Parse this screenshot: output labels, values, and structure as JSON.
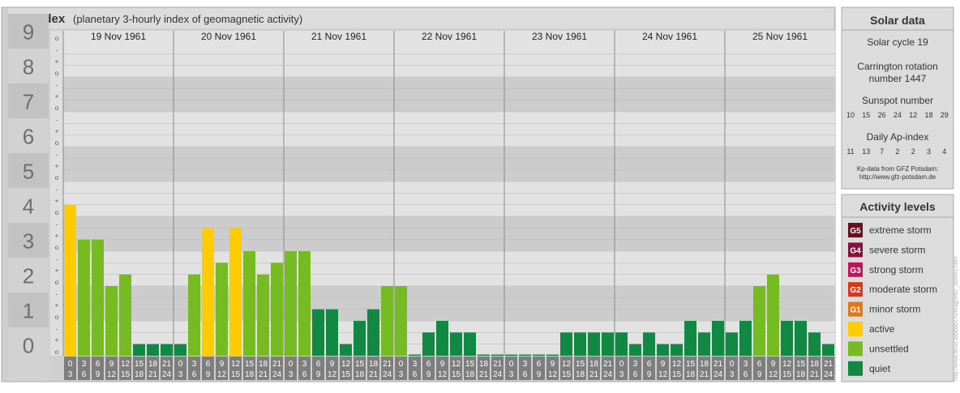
{
  "header": {
    "title": "Kp-index",
    "subtitle": "(planetary 3-hourly index of geomagnetic activity)"
  },
  "colors": {
    "quiet": "#118844",
    "unsettled": "#77bb22",
    "active": "#ffcc00",
    "G1": "#e07818",
    "G2": "#d83818",
    "G3": "#c0145a",
    "G4": "#881040",
    "G5": "#661020",
    "tile": "#7e7e7e",
    "panel": "#dcdcdc"
  },
  "chart_data": {
    "type": "bar",
    "ylim": [
      0,
      9
    ],
    "y_major_ticks": [
      "0",
      "1",
      "2",
      "3",
      "4",
      "5",
      "6",
      "7",
      "8",
      "9"
    ],
    "y_minor_ticks": [
      "-",
      "o",
      "+"
    ],
    "days": [
      "19 Nov 1961",
      "20 Nov 1961",
      "21 Nov 1961",
      "22 Nov 1961",
      "23 Nov 1961",
      "24 Nov 1961",
      "25 Nov 1961"
    ],
    "interval_labels": [
      [
        "0",
        "3"
      ],
      [
        "3",
        "6"
      ],
      [
        "6",
        "9"
      ],
      [
        "9",
        "12"
      ],
      [
        "12",
        "15"
      ],
      [
        "15",
        "18"
      ],
      [
        "18",
        "21"
      ],
      [
        "21",
        "24"
      ]
    ],
    "values": [
      [
        4.333,
        3.333,
        3.333,
        2.0,
        2.333,
        0.333,
        0.333,
        0.333
      ],
      [
        0.333,
        2.333,
        3.667,
        2.667,
        3.667,
        3.0,
        2.333,
        2.667
      ],
      [
        3.0,
        3.0,
        1.333,
        1.333,
        0.333,
        1.0,
        1.333,
        2.0
      ],
      [
        2.0,
        0.0,
        0.667,
        1.0,
        0.667,
        0.667,
        0.0,
        0.0
      ],
      [
        0.0,
        0.0,
        0.0,
        0.0,
        0.667,
        0.667,
        0.667,
        0.667
      ],
      [
        0.667,
        0.333,
        0.667,
        0.333,
        0.333,
        1.0,
        0.667,
        1.0
      ],
      [
        0.667,
        1.0,
        2.0,
        2.333,
        1.0,
        1.0,
        0.667,
        0.333
      ]
    ]
  },
  "solar": {
    "title": "Solar data",
    "cycle": "Solar cycle 19",
    "carrington_line1": "Carrington rotation",
    "carrington_line2": "number 1447",
    "sunspot_label": "Sunspot number",
    "sunspot_values": [
      "10",
      "15",
      "26",
      "24",
      "12",
      "18",
      "29"
    ],
    "ap_label": "Daily Ap-index",
    "ap_values": [
      "11",
      "13",
      "7",
      "2",
      "2",
      "3",
      "4"
    ],
    "source_line1": "Kp-data from GFZ Potsdam:",
    "source_line2": "http://www.gfz-potsdam.de"
  },
  "activity": {
    "title": "Activity levels",
    "items": [
      {
        "badge": "G5",
        "label": "extreme storm",
        "color_key": "G5"
      },
      {
        "badge": "G4",
        "label": "severe storm",
        "color_key": "G4"
      },
      {
        "badge": "G3",
        "label": "strong storm",
        "color_key": "G3"
      },
      {
        "badge": "G2",
        "label": "moderate storm",
        "color_key": "G2"
      },
      {
        "badge": "G1",
        "label": "minor storm",
        "color_key": "G1"
      },
      {
        "badge": "",
        "label": "active",
        "color_key": "active"
      },
      {
        "badge": "",
        "label": "unsettled",
        "color_key": "unsettled"
      },
      {
        "badge": "",
        "label": "quiet",
        "color_key": "quiet"
      }
    ]
  },
  "watermark": "http://www.tesis.lebedev.ru/magnetic_storms.html"
}
